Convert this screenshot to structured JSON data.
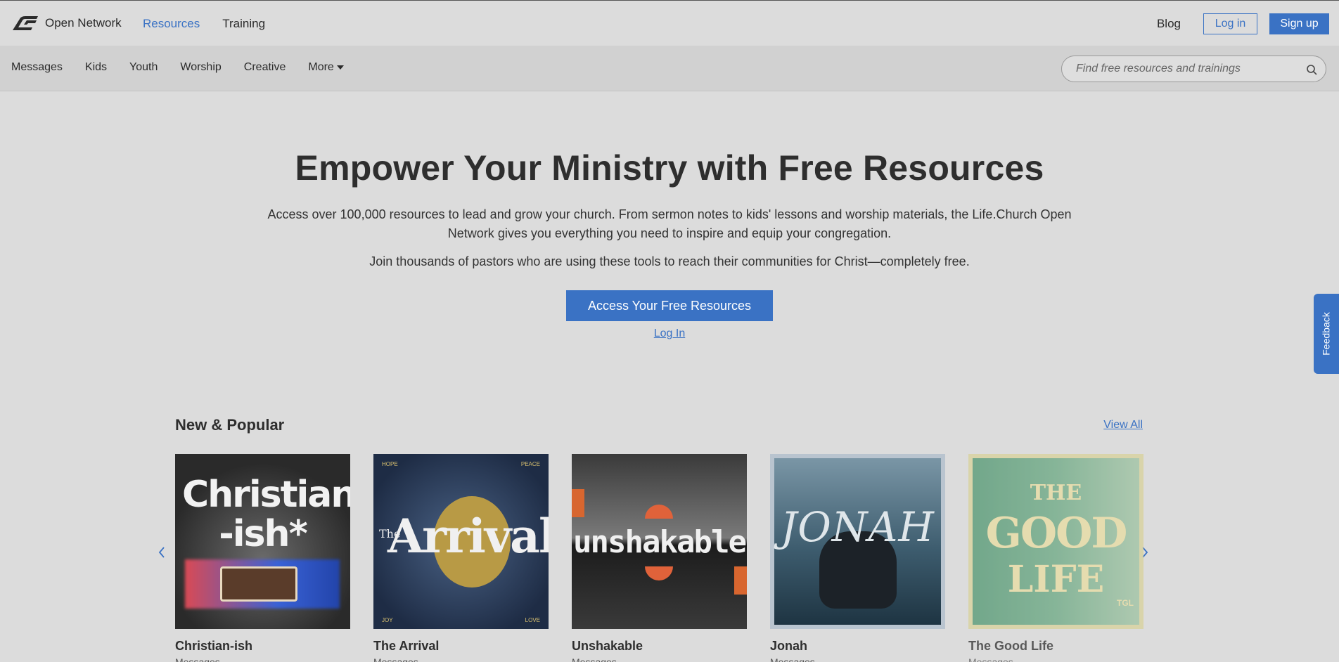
{
  "brand": {
    "name": "Open Network"
  },
  "topnav": {
    "resources": "Resources",
    "training": "Training",
    "blog": "Blog",
    "login": "Log in",
    "signup": "Sign up"
  },
  "subnav": {
    "items": [
      "Messages",
      "Kids",
      "Youth",
      "Worship",
      "Creative",
      "More"
    ],
    "search_placeholder": "Find free resources and trainings"
  },
  "hero": {
    "title": "Empower Your Ministry with Free Resources",
    "p1": "Access over 100,000 resources to lead and grow your church. From sermon notes to kids' lessons and worship materials, the Life.Church Open Network gives you everything you need to inspire and equip your congregation.",
    "p2": "Join thousands of pastors who are using these tools to reach their communities for Christ—completely free.",
    "cta": "Access Your Free Resources",
    "login": "Log In"
  },
  "feedback": "Feedback",
  "section": {
    "title": "New & Popular",
    "view_all": "View All",
    "cards": [
      {
        "title": "Christian-ish",
        "category": "Messages",
        "art": "Christian -ish*"
      },
      {
        "title": "The Arrival",
        "category": "Messages",
        "art": "Arrival",
        "art_small": "The",
        "corners": [
          "HOPE",
          "PEACE",
          "JOY",
          "LOVE"
        ]
      },
      {
        "title": "Unshakable",
        "category": "Messages",
        "art": "unshakable"
      },
      {
        "title": "Jonah",
        "category": "Messages",
        "art": "JONAH"
      },
      {
        "title": "The Good Life",
        "category": "Messages",
        "art_top": "THE",
        "art": "GOOD",
        "art_bottom": "LIFE",
        "art_tag": "TGL"
      }
    ]
  },
  "colors": {
    "accent": "#3a72c4",
    "background": "#dcdcdc"
  }
}
